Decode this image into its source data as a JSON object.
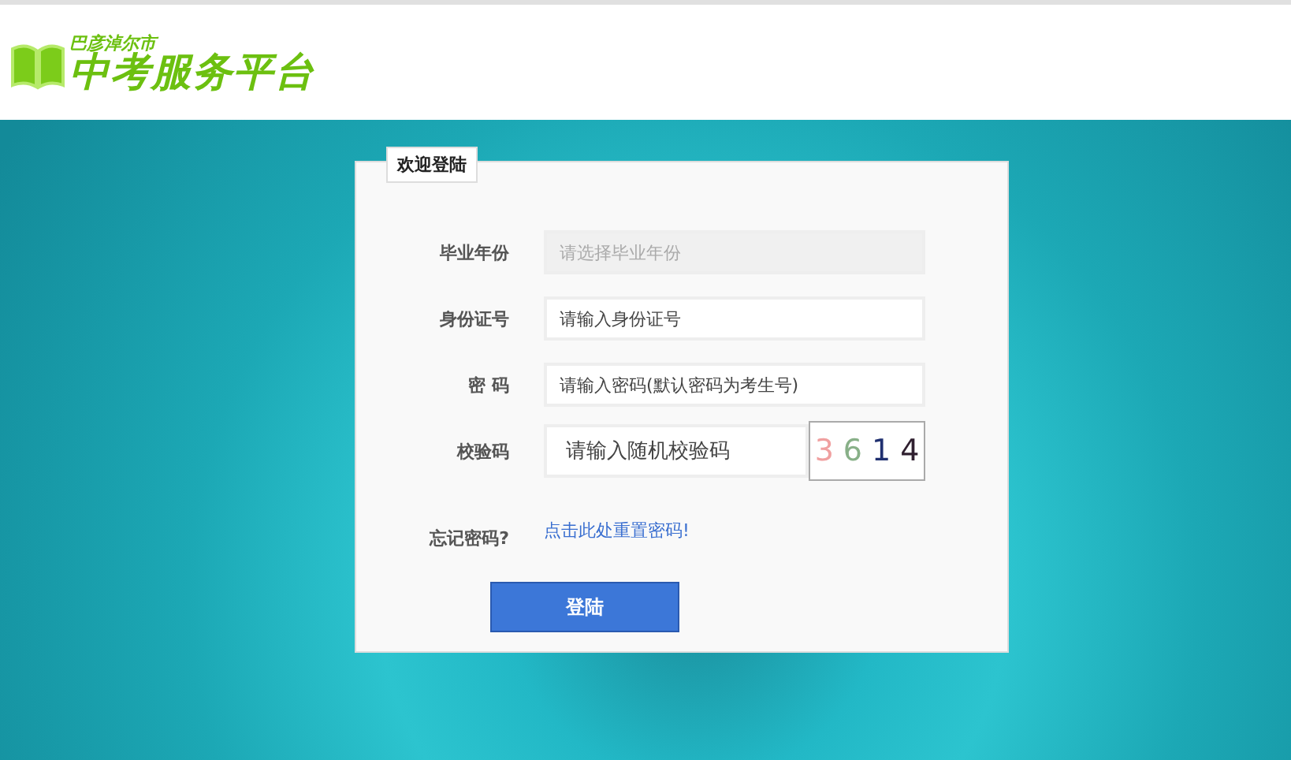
{
  "header": {
    "city": "巴彦淖尔市",
    "title": "中考服务平台"
  },
  "login": {
    "tab": "欢迎登陆",
    "fields": [
      {
        "label": "毕业年份",
        "kind": "select",
        "placeholder": "请选择毕业年份"
      },
      {
        "label": "身份证号",
        "kind": "text",
        "placeholder": "请输入身份证号"
      },
      {
        "label": "密 码",
        "kind": "text",
        "placeholder": "请输入密码(默认密码为考生号)"
      },
      {
        "label": "校验码",
        "kind": "captcha",
        "placeholder": "请输入随机校验码",
        "captcha": [
          {
            "digit": "3",
            "color": "#f0a0a0"
          },
          {
            "digit": "6",
            "color": "#88b088"
          },
          {
            "digit": "1",
            "color": "#203070"
          },
          {
            "digit": "4",
            "color": "#302030"
          }
        ]
      }
    ],
    "forgot_label": "忘记密码?",
    "forgot_link": "点击此处重置密码!",
    "submit": "登陆"
  }
}
